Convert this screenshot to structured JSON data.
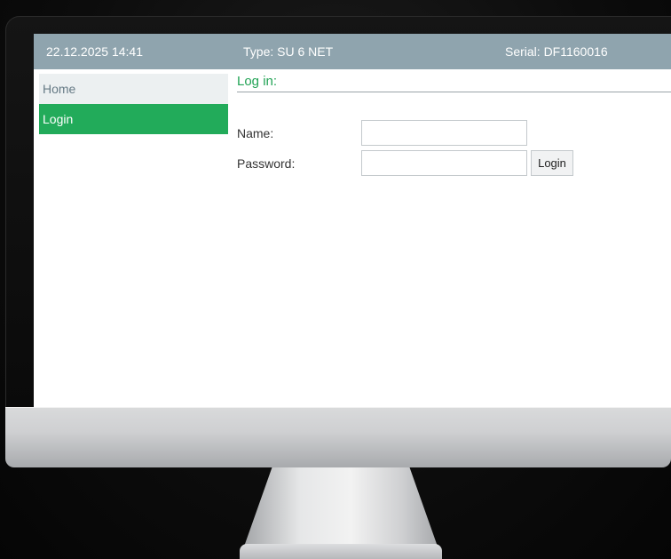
{
  "header": {
    "datetime": "22.12.2025 14:41",
    "type": "Type: SU 6 NET",
    "serial": "Serial: DF1160016"
  },
  "sidebar": {
    "items": [
      {
        "label": "Home",
        "active": false
      },
      {
        "label": "Login",
        "active": true
      }
    ]
  },
  "login_form": {
    "title": "Log in:",
    "name_label": "Name:",
    "name_value": "",
    "password_label": "Password:",
    "password_value": "",
    "login_button": "Login"
  },
  "colors": {
    "header_bg": "#8fa4ae",
    "active_nav_bg": "#22ab5a",
    "title_green": "#22a355"
  }
}
